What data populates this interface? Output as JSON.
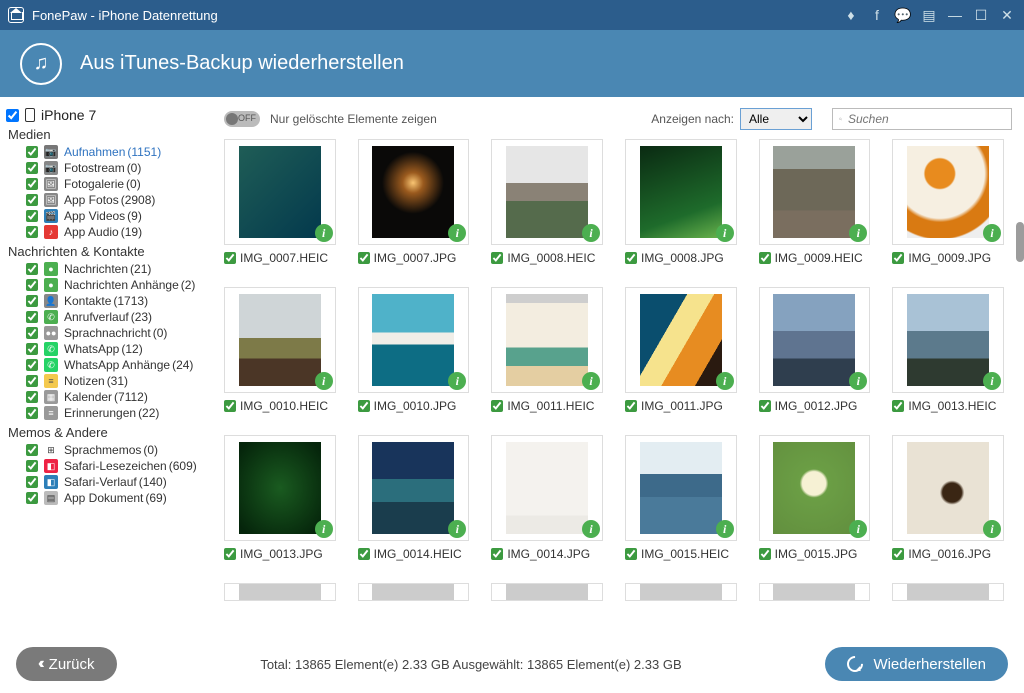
{
  "titlebar": {
    "title": "FonePaw - iPhone Datenrettung"
  },
  "header": {
    "title": "Aus iTunes-Backup wiederherstellen"
  },
  "sidebar": {
    "device": "iPhone 7",
    "sections": [
      {
        "title": "Medien",
        "items": [
          {
            "label": "Aufnahmen",
            "count": "(1151)",
            "active": true,
            "ic": "📷",
            "bg": "#777",
            "col": "#fff"
          },
          {
            "label": "Fotostream",
            "count": "(0)",
            "ic": "📷",
            "bg": "#888",
            "col": "#fff"
          },
          {
            "label": "Fotogalerie",
            "count": "(0)",
            "ic": "🖼",
            "bg": "#888",
            "col": "#fff"
          },
          {
            "label": "App Fotos",
            "count": "(2908)",
            "ic": "🖼",
            "bg": "#888",
            "col": "#fff"
          },
          {
            "label": "App Videos",
            "count": "(9)",
            "ic": "🎬",
            "bg": "#2d7fb8",
            "col": "#fff"
          },
          {
            "label": "App Audio",
            "count": "(19)",
            "ic": "♪",
            "bg": "#e53935",
            "col": "#fff"
          }
        ]
      },
      {
        "title": "Nachrichten & Kontakte",
        "items": [
          {
            "label": "Nachrichten",
            "count": "(21)",
            "ic": "●",
            "bg": "#4caf50",
            "col": "#fff"
          },
          {
            "label": "Nachrichten Anhänge",
            "count": "(2)",
            "ic": "●",
            "bg": "#4caf50",
            "col": "#fff"
          },
          {
            "label": "Kontakte",
            "count": "(1713)",
            "ic": "👤",
            "bg": "#888",
            "col": "#fff"
          },
          {
            "label": "Anrufverlauf",
            "count": "(23)",
            "ic": "✆",
            "bg": "#4caf50",
            "col": "#fff"
          },
          {
            "label": "Sprachnachricht",
            "count": "(0)",
            "ic": "●●",
            "bg": "#999",
            "col": "#fff"
          },
          {
            "label": "WhatsApp",
            "count": "(12)",
            "ic": "✆",
            "bg": "#25d366",
            "col": "#fff"
          },
          {
            "label": "WhatsApp Anhänge",
            "count": "(24)",
            "ic": "✆",
            "bg": "#25d366",
            "col": "#fff"
          },
          {
            "label": "Notizen",
            "count": "(31)",
            "ic": "≡",
            "bg": "#f4c94e",
            "col": "#555"
          },
          {
            "label": "Kalender",
            "count": "(7112)",
            "ic": "▦",
            "bg": "#999",
            "col": "#fff"
          },
          {
            "label": "Erinnerungen",
            "count": "(22)",
            "ic": "≡",
            "bg": "#999",
            "col": "#fff"
          }
        ]
      },
      {
        "title": "Memos & Andere",
        "items": [
          {
            "label": "Sprachmemos",
            "count": "(0)",
            "ic": "⊞",
            "bg": "#fff",
            "col": "#333"
          },
          {
            "label": "Safari-Lesezeichen",
            "count": "(609)",
            "ic": "◧",
            "bg": "#e24",
            "col": "#fff"
          },
          {
            "label": "Safari-Verlauf",
            "count": "(140)",
            "ic": "◧",
            "bg": "#2d7fb8",
            "col": "#fff"
          },
          {
            "label": "App Dokument",
            "count": "(69)",
            "ic": "▤",
            "bg": "#bbb",
            "col": "#333"
          }
        ]
      }
    ]
  },
  "toolbar": {
    "switch_label": "OFF",
    "deleted_only": "Nur gelöschte Elemente zeigen",
    "view_label": "Anzeigen nach:",
    "view_option": "Alle",
    "search_placeholder": "Suchen"
  },
  "thumbnails": [
    {
      "name": "IMG_0007.HEIC",
      "bg": "linear-gradient(135deg,#1f5d56 0%,#03394d 100%)"
    },
    {
      "name": "IMG_0007.JPG",
      "bg": "radial-gradient(circle at 50% 40%,#f9c573 0%,#9a5a1e 15%,#0a0908 45%)"
    },
    {
      "name": "IMG_0008.HEIC",
      "bg": "linear-gradient(180deg,#e6e6e6 0 40%,#8a8276 40% 60%,#556b4c 60% 100%)"
    },
    {
      "name": "IMG_0008.JPG",
      "bg": "linear-gradient(160deg,#0a2a12 0%,#1e6b2b 70%,#69b24c 100%)"
    },
    {
      "name": "IMG_0009.HEIC",
      "bg": "linear-gradient(180deg,#9aa19a 0 25%,#6d6858 25% 70%,#7a6e5f 70% 100%)"
    },
    {
      "name": "IMG_0009.JPG",
      "bg": "radial-gradient(circle at 40% 30%,#e88b1e 0 18%,#f6efe1 20% 55%,#d97a12 60% 80%,#eee 82%)"
    },
    {
      "name": "IMG_0010.HEIC",
      "bg": "linear-gradient(180deg,#cfd5d7 0 48%,#7d7a48 48% 70%,#4b3626 70%)"
    },
    {
      "name": "IMG_0010.JPG",
      "bg": "linear-gradient(180deg,#4fb2c9 0 42%,#f0eee8 42% 55%,#0d6d84 55% 100%)"
    },
    {
      "name": "IMG_0011.HEIC",
      "bg": "linear-gradient(180deg,#cecece 0 10%,#f3ede0 10% 58%,#58a28d 58% 78%,#e4cea2 78%)"
    },
    {
      "name": "IMG_0011.JPG",
      "bg": "linear-gradient(120deg,#0a4e6e 0 35%,#f6e38d 35% 55%,#e78c21 55% 80%,#2a1a10 80%)"
    },
    {
      "name": "IMG_0012.JPG",
      "bg": "linear-gradient(180deg,#85a2bf 0 40%,#5f7490 40% 70%,#2f3e4e 70%)"
    },
    {
      "name": "IMG_0013.HEIC",
      "bg": "linear-gradient(180deg,#a9c2d6 0 40%,#5c7a8c 40% 70%,#2e3a30 70%)"
    },
    {
      "name": "IMG_0013.JPG",
      "bg": "radial-gradient(ellipse at 50% 50%,#1a5b20 0%,#05250b 90%)"
    },
    {
      "name": "IMG_0014.HEIC",
      "bg": "linear-gradient(180deg,#18345b 0 40%,#2b6e7c 40% 65%,#1a3d4d 65%)"
    },
    {
      "name": "IMG_0014.JPG",
      "bg": "linear-gradient(180deg,#f4f2ee 0 80%,#eceae5 80%)"
    },
    {
      "name": "IMG_0015.HEIC",
      "bg": "linear-gradient(180deg,#e3edf2 0 35%,#3d6a8a 35% 60%,#4a7a9a 60%)"
    },
    {
      "name": "IMG_0015.JPG",
      "bg": "radial-gradient(circle at 50% 45%,#f6f1d4 0 18%,#6b9e45 22%,#628f3e 100%)"
    },
    {
      "name": "IMG_0016.JPG",
      "bg": "radial-gradient(circle at 55% 55%,#3a2614 0 14%,#e9e2d4 18% 100%)"
    }
  ],
  "footer": {
    "back": "Zurück",
    "stats": "Total: 13865 Element(e) 2.33 GB    Ausgewählt: 13865 Element(e) 2.33 GB",
    "restore": "Wiederherstellen"
  }
}
